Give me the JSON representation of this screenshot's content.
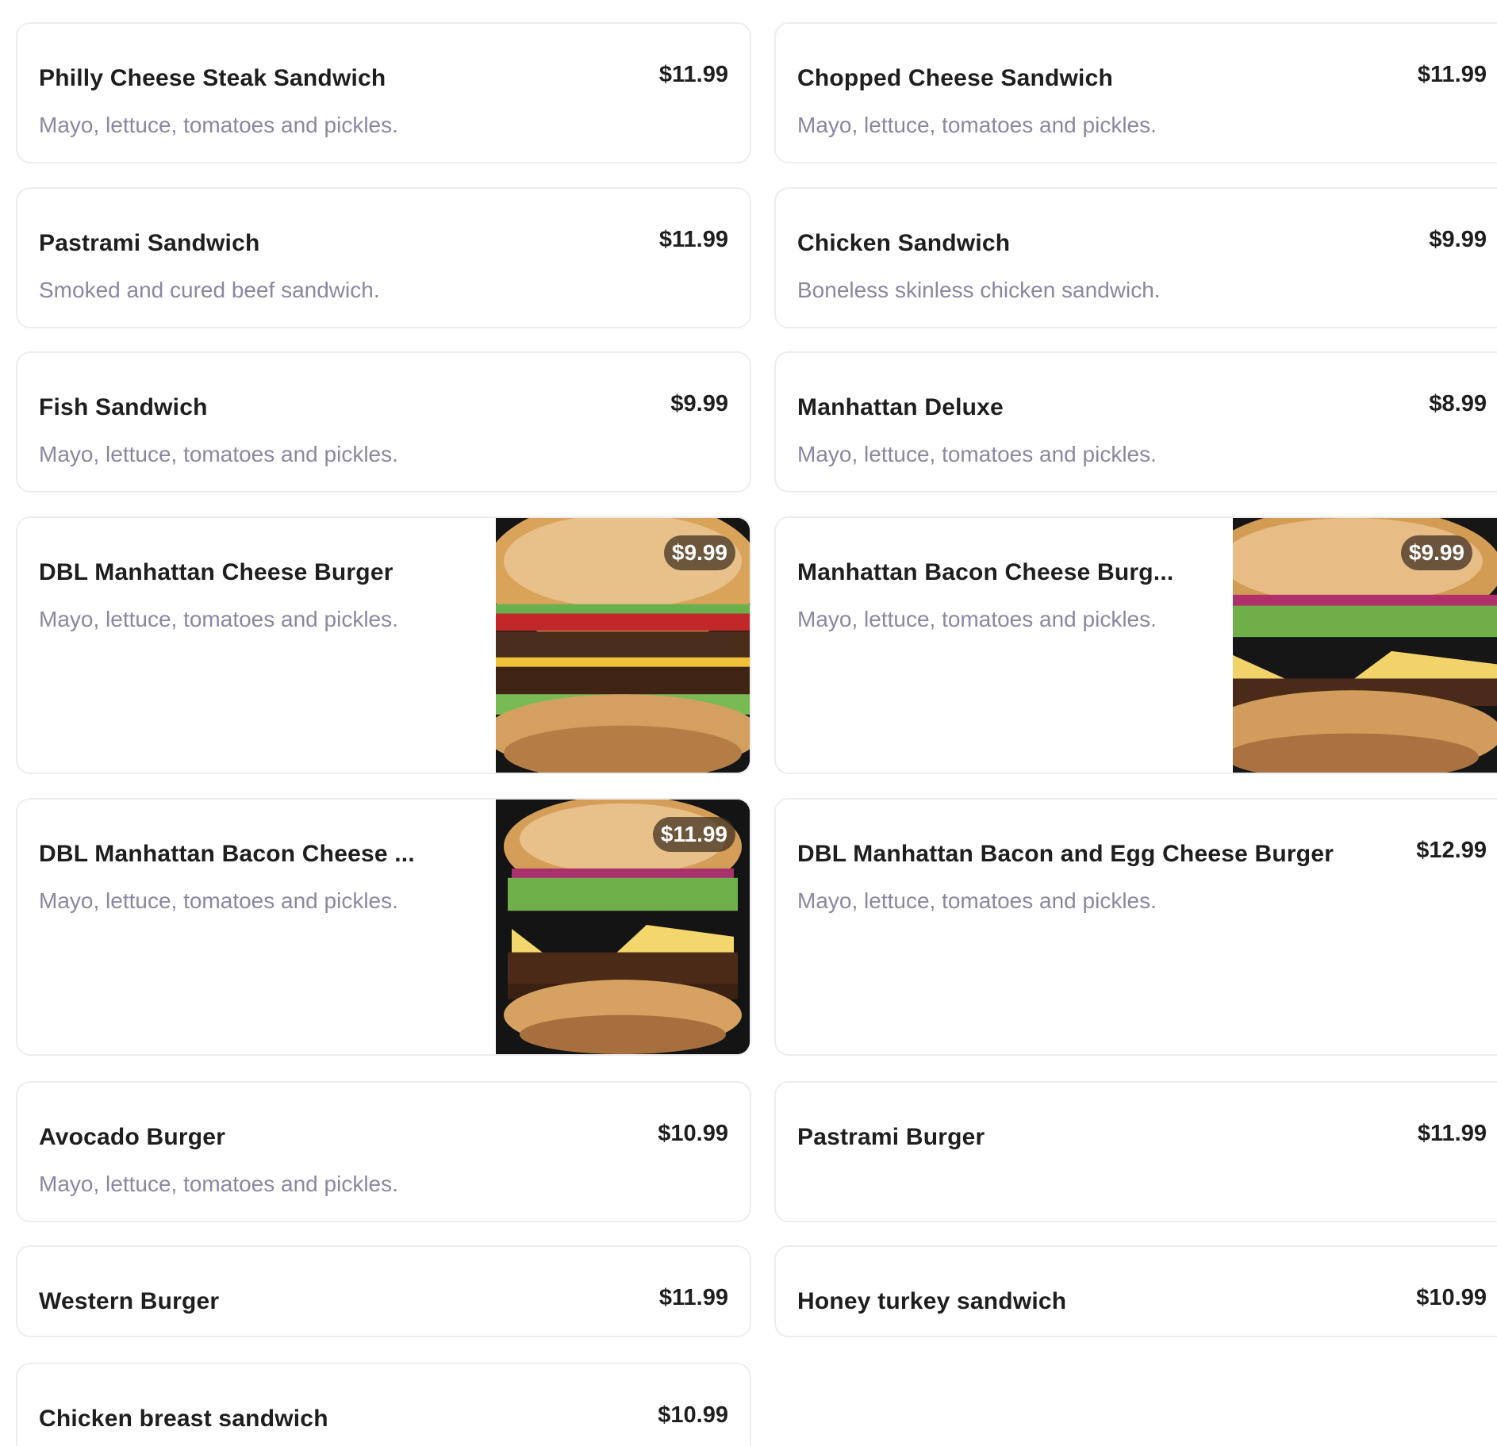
{
  "menu": {
    "items": [
      {
        "name": "Philly Cheese Steak Sandwich",
        "description": "Mayo, lettuce, tomatoes and pickles.",
        "price": "$11.99"
      },
      {
        "name": "Chopped Cheese Sandwich",
        "description": "Mayo, lettuce, tomatoes and pickles.",
        "price": "$11.99"
      },
      {
        "name": "Pastrami Sandwich",
        "description": "Smoked and cured beef sandwich.",
        "price": "$11.99"
      },
      {
        "name": "Chicken Sandwich",
        "description": "Boneless skinless chicken sandwich.",
        "price": "$9.99"
      },
      {
        "name": "Fish Sandwich",
        "description": "Mayo, lettuce, tomatoes and pickles.",
        "price": "$9.99"
      },
      {
        "name": "Manhattan Deluxe",
        "description": "Mayo, lettuce, tomatoes and pickles.",
        "price": "$8.99"
      },
      {
        "name": "DBL Manhattan Cheese Burger",
        "description": "Mayo, lettuce, tomatoes and pickles.",
        "price": "$9.99",
        "image": "burger-photo"
      },
      {
        "name": "Manhattan Bacon Cheese Burg...",
        "description": "Mayo, lettuce, tomatoes and pickles.",
        "price": "$9.99",
        "image": "burger-photo"
      },
      {
        "name": "DBL Manhattan Bacon Cheese ...",
        "description": "Mayo, lettuce, tomatoes and pickles.",
        "price": "$11.99",
        "image": "burger-photo"
      },
      {
        "name": "DBL Manhattan Bacon and Egg Cheese Burger",
        "description": "Mayo, lettuce, tomatoes and pickles.",
        "price": "$12.99"
      },
      {
        "name": "Avocado Burger",
        "description": "Mayo, lettuce, tomatoes and pickles.",
        "price": "$10.99"
      },
      {
        "name": "Pastrami Burger",
        "description": "",
        "price": "$11.99"
      },
      {
        "name": "Western Burger",
        "description": "",
        "price": "$11.99"
      },
      {
        "name": "Honey turkey sandwich",
        "description": "",
        "price": "$10.99"
      },
      {
        "name": "Chicken breast sandwich",
        "description": "",
        "price": "$10.99"
      }
    ]
  },
  "colors": {
    "card_border": "#ededf0",
    "name_text": "#1e1e1e",
    "description_text": "#8a88a0",
    "price_pill_bg": "#3c2d1e"
  }
}
